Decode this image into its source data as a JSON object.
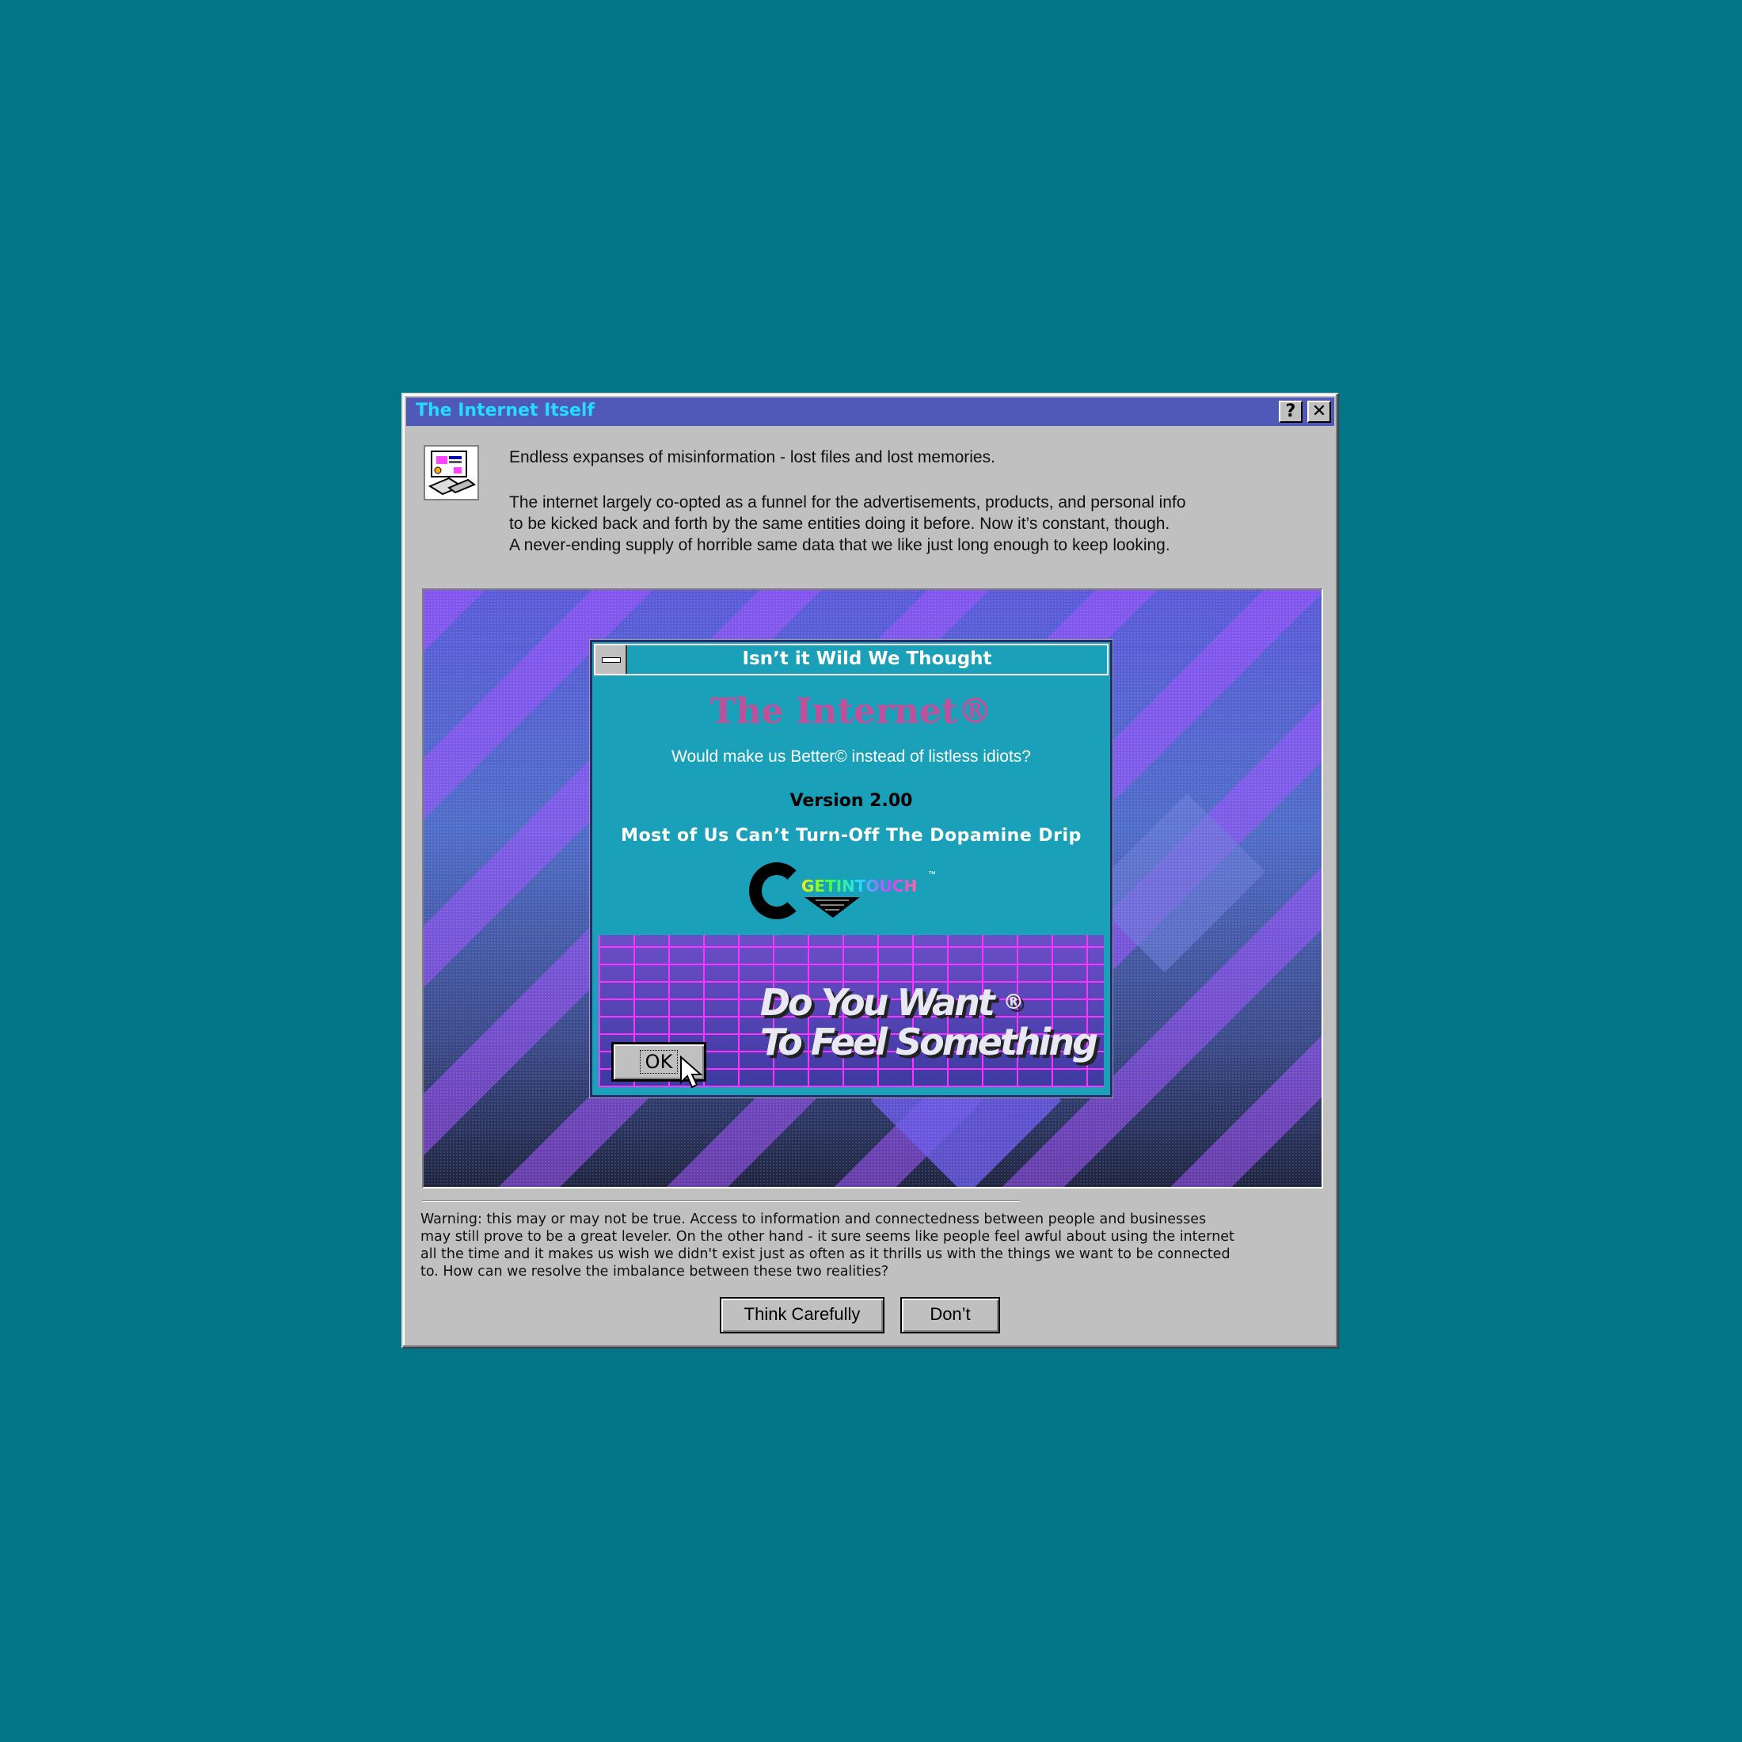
{
  "window": {
    "title": "The Internet Itself",
    "help_glyph": "?",
    "close_glyph": "✕",
    "icon": "network-computer-icon",
    "desc_line1": "Endless expanses of misinformation - lost files and lost memories.",
    "desc_line2": "The internet largely co-opted as a funnel for the advertisements, products, and personal info",
    "desc_line3": "to be kicked back and forth by the same entities doing it before. Now it’s constant, though.",
    "desc_line4": "A never-ending supply of horrible same data that we like just long enough to keep looking.",
    "warning": "Warning: this may or may not be true. Access to information and connectedness between people and businesses\nmay still prove to be a great leveler. On the other hand - it sure seems like people feel awful about using the internet\nall the time and it makes us wish we didn't exist just as often as it thrills us with the things we want to be connected\nto. How can we resolve the imbalance between these two realities?",
    "think_button": "Think Carefully",
    "dont_button": "Don’t"
  },
  "dialog": {
    "title": "Isn’t it Wild We Thought",
    "brand": "The Internet®",
    "question": "Would make us Better©  instead of listless idiots?",
    "version": "Version 2.00",
    "tagline": "Most of Us Can’t Turn-Off The Dopamine Drip",
    "logo_text": "GETINTOUCH",
    "logo_tm": "™",
    "slogan_line1": "Do You Want",
    "slogan_reg": "®",
    "slogan_line2": "To Feel Something",
    "ok_label": "OK"
  },
  "colors": {
    "desktop": "#027587",
    "titlebar": "#5058b8",
    "title_text": "#22ddff",
    "brand": "#c0509a",
    "dialog_bg": "#1aa0b8"
  }
}
